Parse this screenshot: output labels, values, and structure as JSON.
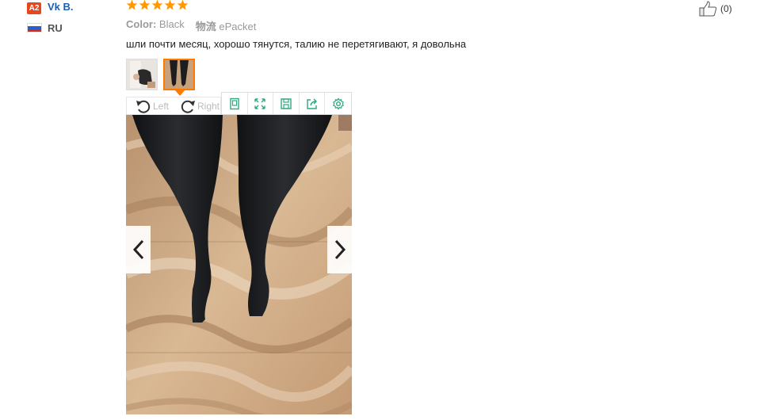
{
  "reviewer": {
    "level_badge": "A2",
    "name": "Vk B.",
    "country": "RU",
    "flag_colors": [
      "#ffffff",
      "#2b5fc7",
      "#d52b1e"
    ]
  },
  "review": {
    "rating": 5,
    "star_color": "#ff9a00",
    "color_label": "Color:",
    "color_value": "Black",
    "shipping_label": "物流",
    "shipping_value": "ePacket",
    "text": "шли почти месяц, хорошо тянутся, талию не перетягивают, я довольна"
  },
  "viewer": {
    "rotate_left_label": "Left",
    "rotate_right_label": "Right",
    "toolbar_icons": [
      "fit-icon",
      "fullscreen-icon",
      "save-icon",
      "share-icon",
      "settings-icon"
    ],
    "accent_color": "#2ea87e",
    "selected_thumb_color": "#ff7a00"
  },
  "helpful": {
    "count": "(0)"
  }
}
